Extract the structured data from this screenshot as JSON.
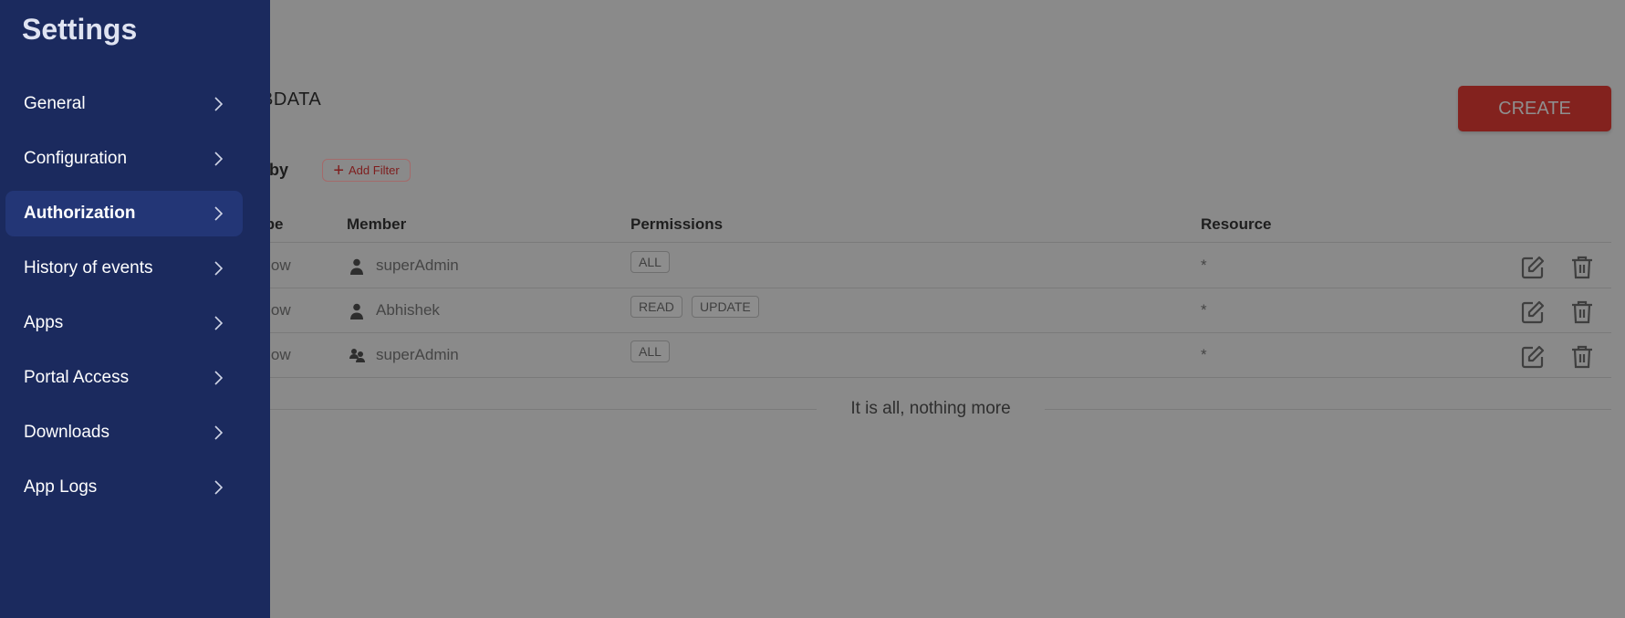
{
  "sidebar": {
    "title": "Settings",
    "items": [
      {
        "label": "General",
        "active": false
      },
      {
        "label": "Configuration",
        "active": false
      },
      {
        "label": "Authorization",
        "active": true
      },
      {
        "label": "History of events",
        "active": false
      },
      {
        "label": "Apps",
        "active": false
      },
      {
        "label": "Portal Access",
        "active": false
      },
      {
        "label": "Downloads",
        "active": false
      },
      {
        "label": "App Logs",
        "active": false
      }
    ]
  },
  "main": {
    "title": "BDATA",
    "create_label": "CREATE",
    "filter_label": "Filter by",
    "add_filter_label": "Add Filter",
    "columns": {
      "type": "Type",
      "member": "Member",
      "permissions": "Permissions",
      "resource": "Resource"
    },
    "rows": [
      {
        "type": "Allow",
        "member": "superAdmin",
        "member_icon": "user-icon",
        "permissions": [
          "ALL"
        ],
        "resource": "*"
      },
      {
        "type": "Allow",
        "member": "Abhishek",
        "member_icon": "user-icon",
        "permissions": [
          "READ",
          "UPDATE"
        ],
        "resource": "*"
      },
      {
        "type": "Allow",
        "member": "superAdmin",
        "member_icon": "group-icon",
        "permissions": [
          "ALL"
        ],
        "resource": "*"
      }
    ],
    "footer": "It is all, nothing more"
  },
  "colors": {
    "sidebar": "#1b2a5e",
    "active_item": "#233676",
    "create_button": "#83221e",
    "overlay": "#8a8a8a"
  }
}
